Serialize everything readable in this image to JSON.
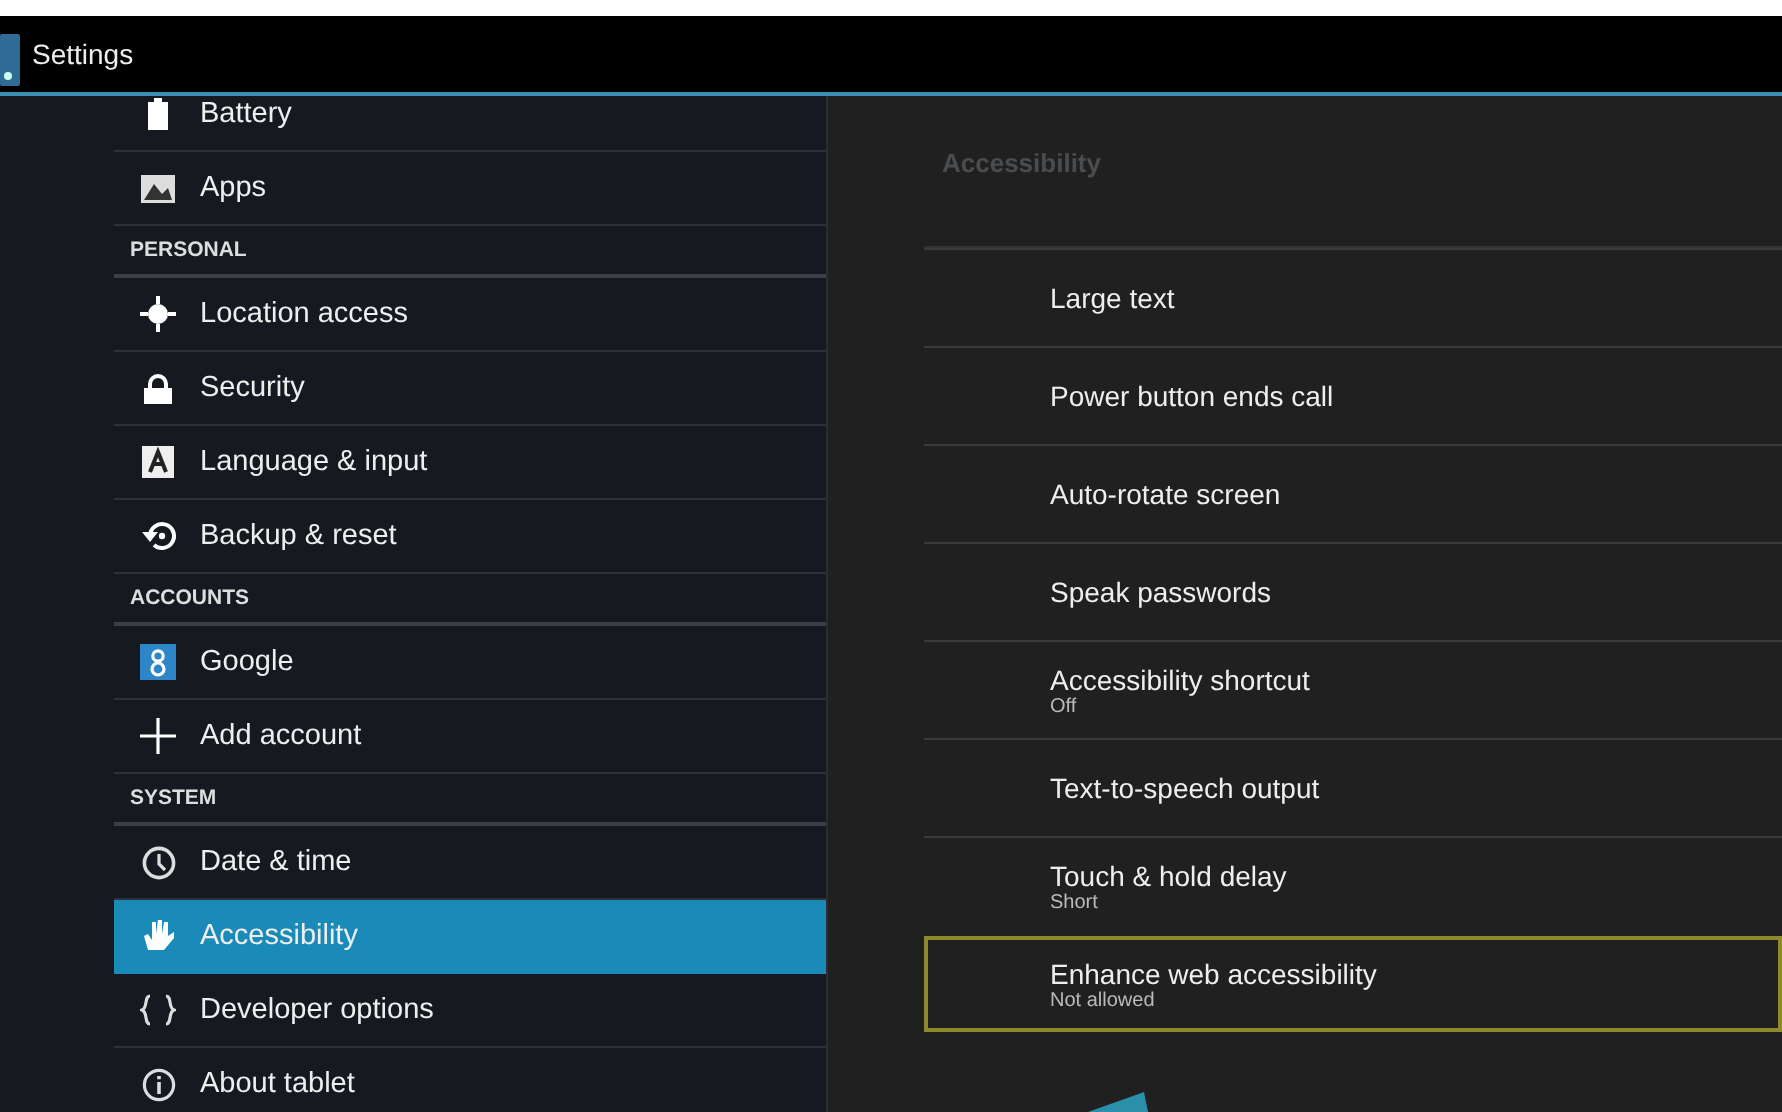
{
  "action_bar": {
    "title": "Settings"
  },
  "sidebar": {
    "items": [
      {
        "kind": "item",
        "label": "Battery",
        "selected": false
      },
      {
        "kind": "item",
        "label": "Apps",
        "selected": false
      },
      {
        "kind": "header",
        "label": "PERSONAL"
      },
      {
        "kind": "item",
        "label": "Location access",
        "selected": false
      },
      {
        "kind": "item",
        "label": "Security",
        "selected": false
      },
      {
        "kind": "item",
        "label": "Language & input",
        "selected": false
      },
      {
        "kind": "item",
        "label": "Backup & reset",
        "selected": false
      },
      {
        "kind": "header",
        "label": "ACCOUNTS"
      },
      {
        "kind": "item",
        "label": "Google",
        "selected": false
      },
      {
        "kind": "item",
        "label": "Add account",
        "selected": false
      },
      {
        "kind": "header",
        "label": "SYSTEM"
      },
      {
        "kind": "item",
        "label": "Date & time",
        "selected": false
      },
      {
        "kind": "item",
        "label": "Accessibility",
        "selected": true
      },
      {
        "kind": "item",
        "label": "Developer options",
        "selected": false
      },
      {
        "kind": "item",
        "label": "About tablet",
        "selected": false
      }
    ]
  },
  "detail": {
    "title": "Accessibility",
    "items": [
      {
        "title": "Large text",
        "focused": false
      },
      {
        "title": "Power button ends call",
        "focused": false
      },
      {
        "title": "Auto-rotate screen",
        "focused": false
      },
      {
        "title": "Speak passwords",
        "focused": false
      },
      {
        "title": "Accessibility shortcut",
        "summary": "Off",
        "focused": false
      },
      {
        "title": "Text-to-speech output",
        "focused": false
      },
      {
        "title": "Touch & hold delay",
        "summary": "Short",
        "focused": false
      },
      {
        "title": "Enhance web accessibility",
        "summary": "Not allowed",
        "focused": true
      }
    ]
  }
}
